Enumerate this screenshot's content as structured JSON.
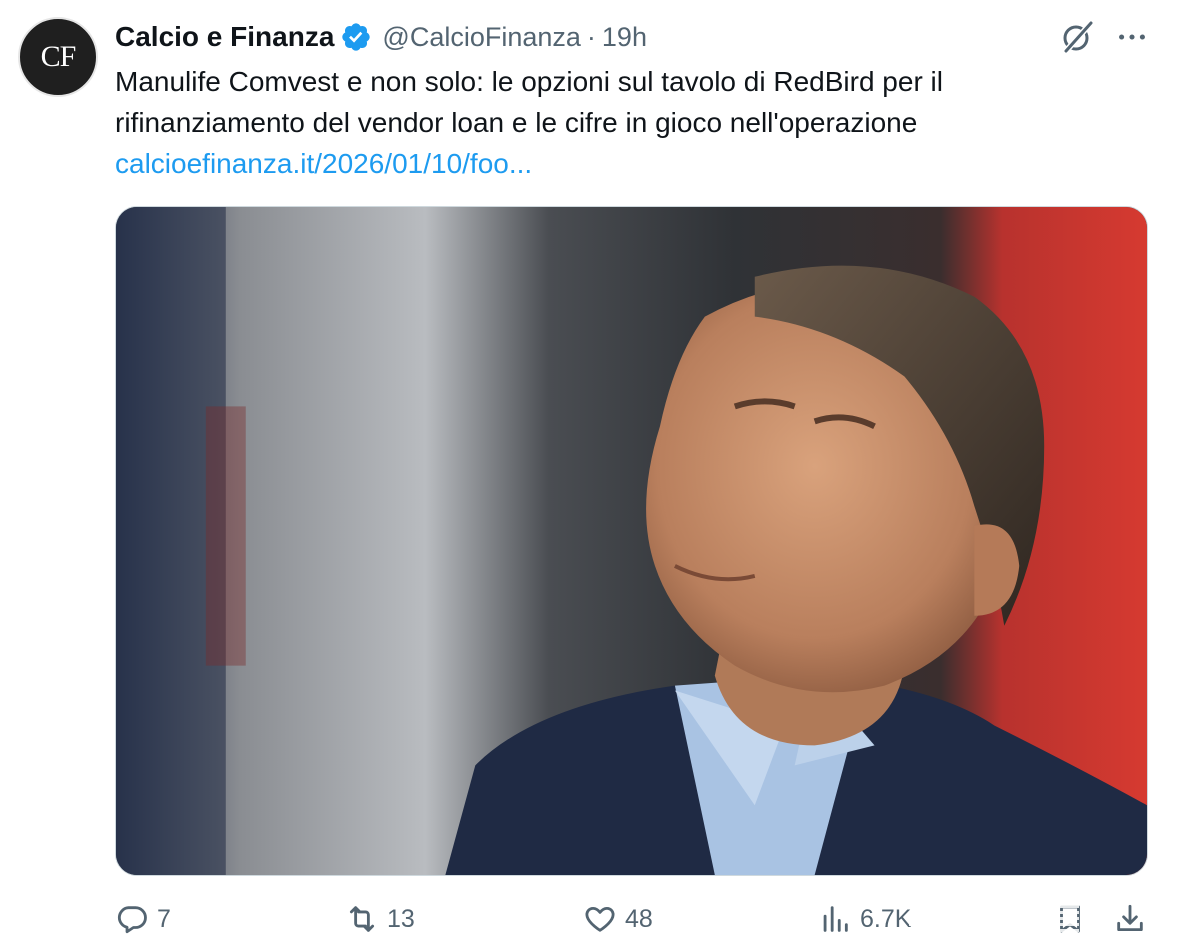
{
  "author": {
    "avatar_text": "CF",
    "display_name": "Calcio e Finanza",
    "handle": "@CalcioFinanza",
    "separator": "·",
    "timestamp": "19h",
    "verified_icon": "verified-badge-icon"
  },
  "tweet": {
    "text": "Manulife Comvest e non solo: le opzioni sul tavolo di RedBird per il rifinanziamento del vendor loan e le cifre in gioco nell'operazione",
    "link": "calcioefinanza.it/2026/01/10/foo..."
  },
  "toolbar": {
    "grok_icon": "grok-icon",
    "more_icon": "more-options-icon"
  },
  "actions": {
    "replies": "7",
    "reposts": "13",
    "likes": "48",
    "views": "6.7K"
  },
  "colors": {
    "link": "#1d9bf0",
    "verified": "#1d9bf0",
    "secondary_text": "#536471",
    "primary_text": "#0f1419"
  }
}
